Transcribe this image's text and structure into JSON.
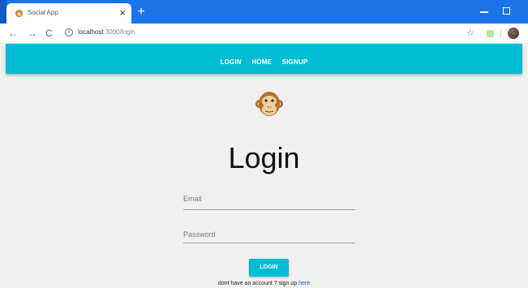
{
  "browser": {
    "tab_title": "Social App",
    "tab_close": "×",
    "new_tab": "+",
    "url_host": "localhost",
    "url_path": ":3000/login",
    "back": "←",
    "forward": "→",
    "reload": "C",
    "star": "☆"
  },
  "app": {
    "nav": [
      "LOGIN",
      "HOME",
      "SIGNUP"
    ],
    "title": "Login",
    "email_label": "Email",
    "password_label": "Password",
    "submit_label": "LOGIN",
    "signup_prompt": "dont have an account ? sign up",
    "signup_link": "here"
  },
  "colors": {
    "accent": "#00bcd4",
    "chrome": "#1a73e8",
    "background": "#f0f0f0"
  }
}
